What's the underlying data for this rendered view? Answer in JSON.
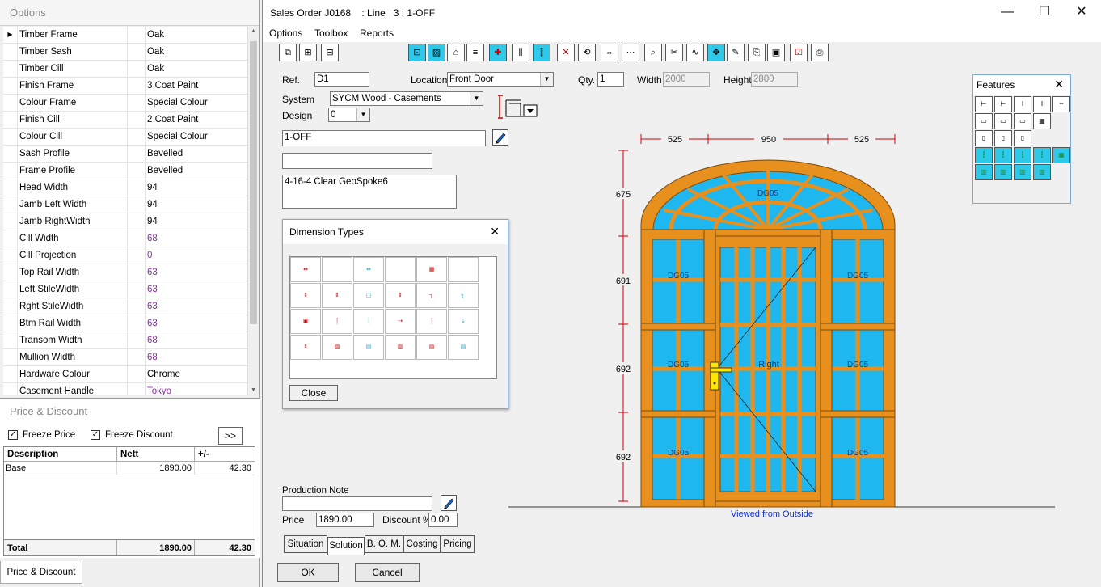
{
  "options_panel": {
    "title": "Options",
    "rows": [
      {
        "key": "Timber Frame",
        "value": "Oak",
        "highlight": false
      },
      {
        "key": "Timber Sash",
        "value": "Oak",
        "highlight": false
      },
      {
        "key": "Timber Cill",
        "value": "Oak",
        "highlight": false
      },
      {
        "key": "Finish Frame",
        "value": "3 Coat Paint",
        "highlight": false
      },
      {
        "key": "Colour Frame",
        "value": "Special Colour",
        "highlight": false
      },
      {
        "key": "Finish Cill",
        "value": "2 Coat Paint",
        "highlight": false
      },
      {
        "key": "Colour Cill",
        "value": "Special Colour",
        "highlight": false
      },
      {
        "key": "Sash Profile",
        "value": "Bevelled",
        "highlight": false
      },
      {
        "key": "Frame Profile",
        "value": "Bevelled",
        "highlight": false
      },
      {
        "key": "Head Width",
        "value": "94",
        "highlight": false
      },
      {
        "key": "Jamb Left Width",
        "value": "94",
        "highlight": false
      },
      {
        "key": "Jamb RightWidth",
        "value": "94",
        "highlight": false
      },
      {
        "key": "Cill Width",
        "value": "68",
        "highlight": true
      },
      {
        "key": "Cill Projection",
        "value": "0",
        "highlight": true
      },
      {
        "key": "Top  Rail Width",
        "value": "63",
        "highlight": true
      },
      {
        "key": "Left StileWidth",
        "value": "63",
        "highlight": true
      },
      {
        "key": "Rght StileWidth",
        "value": "63",
        "highlight": true
      },
      {
        "key": "Btm Rail Width",
        "value": "63",
        "highlight": true
      },
      {
        "key": "Transom Width",
        "value": "68",
        "highlight": true
      },
      {
        "key": "Mullion Width",
        "value": "68",
        "highlight": true
      },
      {
        "key": "Hardware Colour",
        "value": "Chrome",
        "highlight": false
      },
      {
        "key": "Casement Handle",
        "value": "Tokyo",
        "highlight": true
      }
    ]
  },
  "price_panel": {
    "title": "Price & Discount",
    "freeze_price_label": "Freeze Price",
    "freeze_discount_label": "Freeze Discount",
    "expand_label": ">>",
    "headers": {
      "description": "Description",
      "nett": "Nett",
      "plusminus": "+/-"
    },
    "rows": [
      {
        "description": "Base",
        "nett": "1890.00",
        "plusminus": "42.30"
      }
    ],
    "total": {
      "label": "Total",
      "nett": "1890.00",
      "plusminus": "42.30"
    },
    "tab_label": "Price & Discount"
  },
  "window": {
    "title": "Sales Order J0168    : Line   3 : 1-OFF",
    "minimize": "—",
    "maximize": "☐",
    "close": "✕"
  },
  "menu": [
    "Options",
    "Toolbox",
    "Reports"
  ],
  "form": {
    "ref_label": "Ref.",
    "ref_value": "D1",
    "location_label": "Location",
    "location_value": "Front Door",
    "qty_label": "Qty.",
    "qty_value": "1",
    "width_label": "Width",
    "width_value": "2000",
    "height_label": "Height",
    "height_value": "2800",
    "system_label": "System",
    "system_value": "SYCM  Wood - Casements",
    "design_label": "Design",
    "design_value": "0",
    "line_value": "1-OFF",
    "blank_value": "",
    "glass_value": "4-16-4 Clear GeoSpoke6",
    "production_note_label": "Production Note",
    "production_note_value": "",
    "price_label": "Price",
    "price_value": "1890.00",
    "discount_label": "Discount %",
    "discount_value": "0.00"
  },
  "dimension_dialog": {
    "title": "Dimension Types",
    "close_label": "Close"
  },
  "features_dialog": {
    "title": "Features"
  },
  "drawing": {
    "dims_top": [
      "525",
      "950",
      "525"
    ],
    "dims_left": [
      "675",
      "691",
      "692",
      "692"
    ],
    "glass_labels": [
      "DG05",
      "DG05",
      "DG05",
      "DG05",
      "DG05",
      "DG05",
      "DG05"
    ],
    "sash_label": "Right",
    "caption": "Viewed from Outside"
  },
  "tabs": [
    "Situation",
    "Solution",
    "B. O. M.",
    "Costing",
    "Pricing"
  ],
  "buttons": {
    "ok": "OK",
    "cancel": "Cancel"
  },
  "colors": {
    "frame": "#e8901e",
    "glass": "#1fb7f0",
    "dim": "#cc0000",
    "caption": "#1030c8"
  }
}
